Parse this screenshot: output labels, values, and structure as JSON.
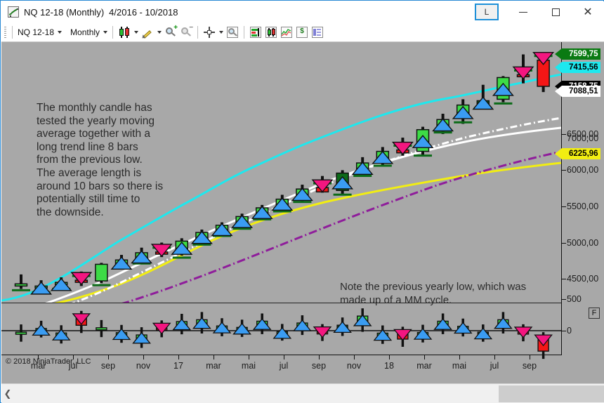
{
  "window": {
    "title_symbol": "NQ 12-18 (Monthly)",
    "title_range": "4/2016 - 10/2018",
    "app_icon": "chart-icon",
    "layout_button": "L",
    "minimize": "minimize-icon",
    "maximize": "maximize-icon",
    "close": "close-icon"
  },
  "toolbar": {
    "instrument": "NQ 12-18",
    "interval": "Monthly",
    "buttons": [
      {
        "name": "chart-style-candle",
        "label": "candlestick-icon"
      },
      {
        "name": "drawing-tools",
        "label": "pencil-icon"
      },
      {
        "name": "zoom-in",
        "label": "magnifier-plus-icon"
      },
      {
        "name": "zoom-out",
        "label": "magnifier-minus-icon"
      },
      {
        "name": "crosshair",
        "label": "crosshair-icon"
      },
      {
        "name": "data-box",
        "label": "magnifier-icon"
      },
      {
        "name": "order-bars",
        "label": "order-bars-icon"
      },
      {
        "name": "indicators",
        "label": "indicators-icon"
      },
      {
        "name": "strategies",
        "label": "line-chart-icon"
      },
      {
        "name": "pnl",
        "label": "dollar-icon"
      },
      {
        "name": "properties",
        "label": "properties-icon"
      }
    ]
  },
  "annotations": {
    "note_main": "The monthly candle has\ntested the yearly moving\naverage together with a\nlong trend line 8 bars\nfrom the previous low.\nThe average length is\naround 10 bars so there is\npotentially still time to\nthe downside.",
    "note_secondary": "Note the previous yearly low, which was\nmade up of a MM cycle.",
    "copyright": "© 2018 NinjaTrader, LLC"
  },
  "price_axis": {
    "ticks": [
      {
        "label": "6500,00",
        "value": 6500
      },
      {
        "label": "6000,00",
        "value": 6000
      },
      {
        "label": "5500,00",
        "value": 5500
      },
      {
        "label": "5000,00",
        "value": 5000
      },
      {
        "label": "4500,00",
        "value": 4500
      }
    ],
    "tags": [
      {
        "label": "7599,75",
        "value": 7599.75,
        "bg": "#0a7a12",
        "fg": "#ffffff",
        "name": "price-tag-high"
      },
      {
        "label": "7415,56",
        "value": 7415.56,
        "bg": "#1ee8ee",
        "fg": "#000000",
        "name": "price-tag-ma"
      },
      {
        "label": "7158,75",
        "value": 7158.75,
        "bg": "#000000",
        "fg": "#ffffff",
        "name": "price-tag-last"
      },
      {
        "label": "7088,51",
        "value": 7088.51,
        "bg": "#ffffff",
        "fg": "#000000",
        "name": "price-tag-ma2"
      },
      {
        "label": "6225,96",
        "value": 6225.96,
        "bg": "#f2ee12",
        "fg": "#000000",
        "name": "price-tag-ma3"
      }
    ],
    "hidden_gridlabel": "7000,00"
  },
  "sub_axis": {
    "ticks": [
      {
        "label": "500",
        "value": 500
      },
      {
        "label": "0",
        "value": 0
      }
    ],
    "fit_button": "F"
  },
  "date_axis": {
    "labels": [
      "mai",
      "jul",
      "sep",
      "nov",
      "17",
      "mar",
      "mai",
      "jul",
      "sep",
      "nov",
      "18",
      "mar",
      "mai",
      "jul",
      "sep"
    ]
  },
  "scrollbar": {
    "left_arrow": "chevron-left-icon",
    "right_arrow": "chevron-right-icon"
  },
  "chart_data": {
    "type": "candlestick",
    "title": "NQ 12-18 (Monthly) 4/2016 - 10/2018",
    "xlabel": "",
    "ylabel": "",
    "ylim": [
      4200,
      7750
    ],
    "grid": false,
    "legend": "none",
    "x_tick_labels": [
      "mai",
      "jul",
      "sep",
      "nov",
      "17",
      "mar",
      "mai",
      "jul",
      "sep",
      "nov",
      "18",
      "mar",
      "mai",
      "jul",
      "sep"
    ],
    "candles": [
      {
        "i": 0,
        "open": 4430,
        "high": 4560,
        "low": 4360,
        "close": 4400,
        "color": "green",
        "marker": "none"
      },
      {
        "i": 1,
        "open": 4400,
        "high": 4480,
        "low": 4330,
        "close": 4380,
        "color": "green",
        "marker": "up"
      },
      {
        "i": 2,
        "open": 4420,
        "high": 4520,
        "low": 4350,
        "close": 4450,
        "color": "green",
        "marker": "up"
      },
      {
        "i": 3,
        "open": 4480,
        "high": 4600,
        "low": 4400,
        "close": 4460,
        "color": "red",
        "marker": "down"
      },
      {
        "i": 4,
        "open": 4470,
        "high": 4720,
        "low": 4440,
        "close": 4700,
        "color": "green",
        "marker": "none"
      },
      {
        "i": 5,
        "open": 4700,
        "high": 4830,
        "low": 4660,
        "close": 4760,
        "color": "green",
        "marker": "up"
      },
      {
        "i": 6,
        "open": 4770,
        "high": 4930,
        "low": 4740,
        "close": 4860,
        "color": "green",
        "marker": "up"
      },
      {
        "i": 7,
        "open": 4870,
        "high": 5000,
        "low": 4800,
        "close": 4840,
        "color": "red",
        "marker": "down"
      },
      {
        "i": 8,
        "open": 4850,
        "high": 5060,
        "low": 4820,
        "close": 5020,
        "color": "green",
        "marker": "up"
      },
      {
        "i": 9,
        "open": 5030,
        "high": 5180,
        "low": 4980,
        "close": 5140,
        "color": "green",
        "marker": "up"
      },
      {
        "i": 10,
        "open": 5150,
        "high": 5280,
        "low": 5100,
        "close": 5240,
        "color": "green",
        "marker": "up"
      },
      {
        "i": 11,
        "open": 5250,
        "high": 5400,
        "low": 5200,
        "close": 5360,
        "color": "green",
        "marker": "up"
      },
      {
        "i": 12,
        "open": 5380,
        "high": 5520,
        "low": 5330,
        "close": 5480,
        "color": "green",
        "marker": "up"
      },
      {
        "i": 13,
        "open": 5490,
        "high": 5660,
        "low": 5430,
        "close": 5600,
        "color": "green",
        "marker": "up"
      },
      {
        "i": 14,
        "open": 5620,
        "high": 5800,
        "low": 5560,
        "close": 5740,
        "color": "green",
        "marker": "up"
      },
      {
        "i": 15,
        "open": 5760,
        "high": 5920,
        "low": 5690,
        "close": 5700,
        "color": "red",
        "marker": "down"
      },
      {
        "i": 16,
        "open": 5720,
        "high": 6000,
        "low": 5660,
        "close": 5960,
        "color": "darkgreen",
        "marker": "up"
      },
      {
        "i": 17,
        "open": 5980,
        "high": 6180,
        "low": 5920,
        "close": 6100,
        "color": "green",
        "marker": "up"
      },
      {
        "i": 18,
        "open": 6120,
        "high": 6320,
        "low": 6060,
        "close": 6260,
        "color": "green",
        "marker": "up"
      },
      {
        "i": 19,
        "open": 6280,
        "high": 6450,
        "low": 6200,
        "close": 6240,
        "color": "red",
        "marker": "down"
      },
      {
        "i": 20,
        "open": 6260,
        "high": 6600,
        "low": 6200,
        "close": 6560,
        "color": "green",
        "marker": "up"
      },
      {
        "i": 21,
        "open": 6580,
        "high": 6780,
        "low": 6500,
        "close": 6700,
        "color": "green",
        "marker": "up"
      },
      {
        "i": 22,
        "open": 6720,
        "high": 6980,
        "low": 6640,
        "close": 6900,
        "color": "green",
        "marker": "up"
      },
      {
        "i": 23,
        "open": 6920,
        "high": 7180,
        "low": 6880,
        "close": 6960,
        "color": "darkgreen",
        "marker": "up"
      },
      {
        "i": 24,
        "open": 6980,
        "high": 7300,
        "low": 6940,
        "close": 7280,
        "color": "green",
        "marker": "up"
      },
      {
        "i": 25,
        "open": 7300,
        "high": 7599.75,
        "low": 7200,
        "close": 7320,
        "color": "red",
        "marker": "down"
      },
      {
        "i": 26,
        "open": 7520,
        "high": 7599.75,
        "low": 7080,
        "close": 7158.75,
        "color": "red",
        "marker": "down"
      }
    ],
    "series": [
      {
        "name": "MA fast",
        "color": "#1ee8ee",
        "style": "solid",
        "last_value": 7415.56
      },
      {
        "name": "MA mid",
        "color": "#ffffff",
        "style": "solid",
        "last_value": 7088.51
      },
      {
        "name": "MA slow",
        "color": "#ffffff",
        "style": "dashdot",
        "last_value": null
      },
      {
        "name": "MA yearly",
        "color": "#8f1d9b",
        "style": "dashdot",
        "last_value": null
      },
      {
        "name": "MA long",
        "color": "#f2ee12",
        "style": "solid",
        "last_value": 6225.96
      }
    ],
    "subpanel": {
      "type": "candlestick",
      "name": "momentum-oscillator",
      "ylim": [
        -600,
        700
      ],
      "zero_line": 0
    },
    "drawings": [
      {
        "type": "circle",
        "name": "pivot-low-marker",
        "x_index": 3
      },
      {
        "type": "trendline",
        "name": "long-trend-line",
        "color": "#8f1d9b"
      }
    ]
  },
  "colors": {
    "chart_background": "#a8a8a8",
    "candle_up": "#3ddb46",
    "candle_up_dark": "#0c6b18",
    "candle_down": "#f41616",
    "marker_up": "#3a9cf2",
    "marker_down": "#f41680",
    "level_line": "#0c6b18",
    "accent": "#1e90d8"
  }
}
